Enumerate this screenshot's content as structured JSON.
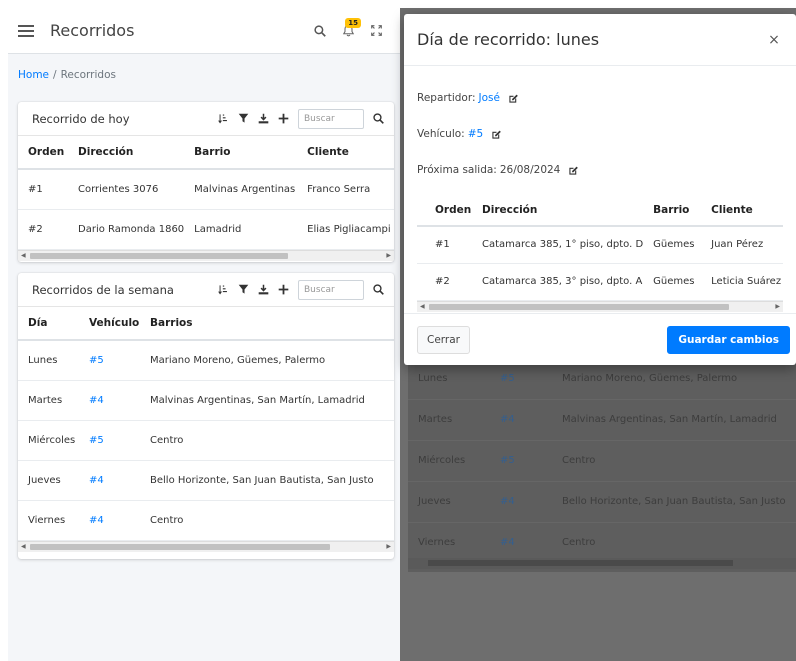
{
  "header": {
    "title": "Recorridos",
    "notification_count": "15"
  },
  "breadcrumb": {
    "home": "Home",
    "current": "Recorridos"
  },
  "today_card": {
    "title": "Recorrido de hoy",
    "search_placeholder": "Buscar",
    "columns": [
      "Orden",
      "Dirección",
      "Barrio",
      "Cliente"
    ],
    "rows": [
      [
        "#1",
        "Corrientes 3076",
        "Malvinas Argentinas",
        "Franco Serra"
      ],
      [
        "#2",
        "Dario Ramonda 1860",
        "Lamadrid",
        "Elias Pigliacampi"
      ]
    ]
  },
  "week_card": {
    "title": "Recorridos de la semana",
    "search_placeholder": "Buscar",
    "columns": [
      "Día",
      "Vehículo",
      "Barrios"
    ],
    "rows": [
      [
        "Lunes",
        "#5",
        "Mariano Moreno, Güemes, Palermo"
      ],
      [
        "Martes",
        "#4",
        "Malvinas Argentinas, San Martín, Lamadrid"
      ],
      [
        "Miércoles",
        "#5",
        "Centro"
      ],
      [
        "Jueves",
        "#4",
        "Bello Horizonte, San Juan Bautista, San Justo"
      ],
      [
        "Viernes",
        "#4",
        "Centro"
      ]
    ]
  },
  "modal": {
    "title": "Día de recorrido: lunes",
    "close_glyph": "×",
    "repartidor_label": "Repartidor: ",
    "repartidor_value": "José",
    "vehiculo_label": "Vehículo: ",
    "vehiculo_value": "#5",
    "salida_label": "Próxima salida: ",
    "salida_value": "26/08/2024",
    "columns": [
      "Orden",
      "Dirección",
      "Barrio",
      "Cliente"
    ],
    "rows": [
      [
        "#1",
        "Catamarca 385, 1° piso, dpto. D",
        "Güemes",
        "Juan Pérez"
      ],
      [
        "#2",
        "Catamarca 385, 3° piso, dpto. A",
        "Güemes",
        "Leticia Suárez"
      ]
    ],
    "cancel_label": "Cerrar",
    "save_label": "Guardar cambios"
  },
  "colors": {
    "primary": "#007bff",
    "badge": "#ffc107",
    "backdrop": "#6e6e6e"
  }
}
